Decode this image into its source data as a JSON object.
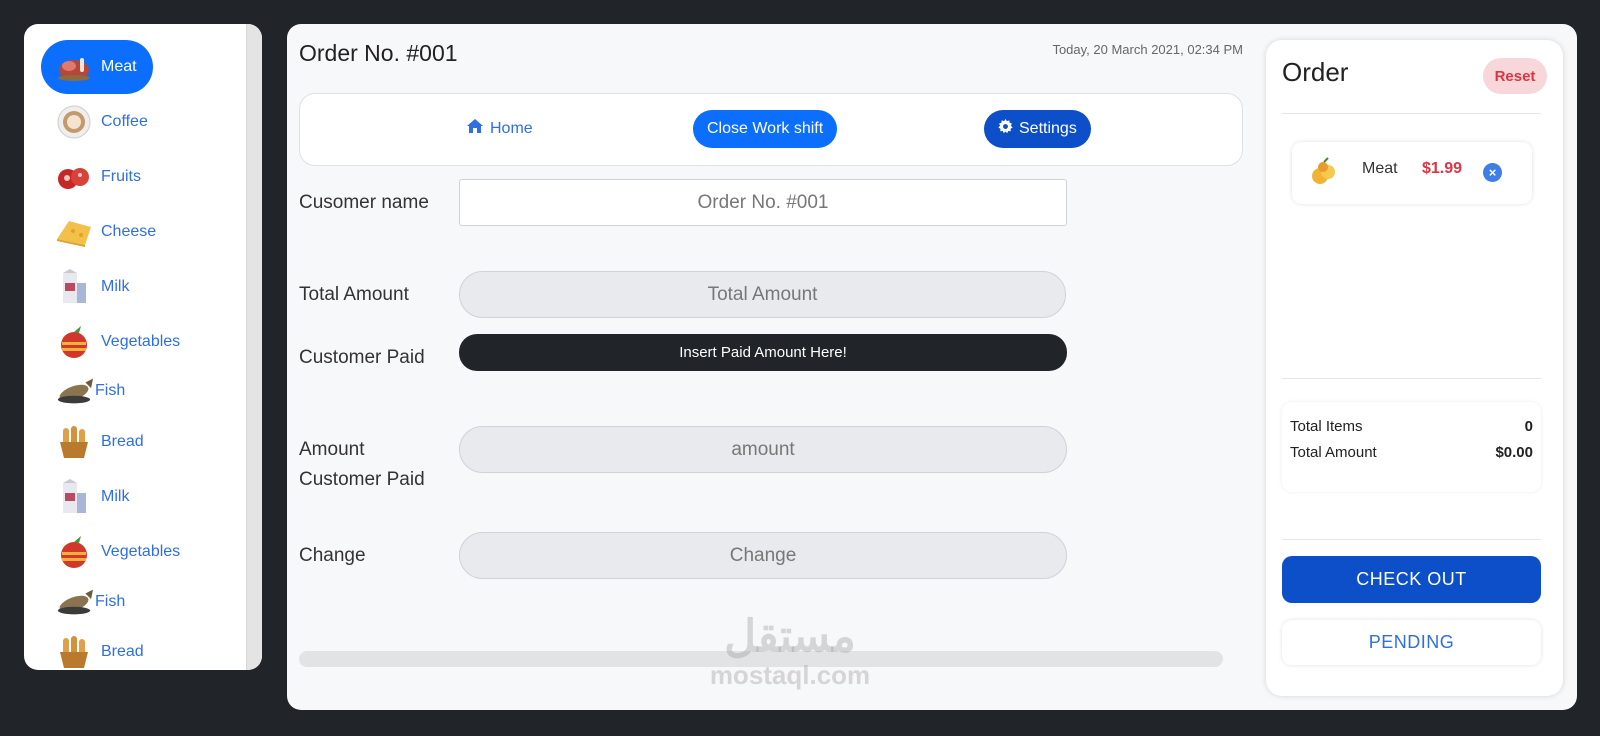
{
  "sidebar": {
    "categories": [
      {
        "label": "Meat",
        "icon": "meat-icon",
        "active": true
      },
      {
        "label": "Coffee",
        "icon": "coffee-icon"
      },
      {
        "label": "Fruits",
        "icon": "fruits-icon"
      },
      {
        "label": "Cheese",
        "icon": "cheese-icon"
      },
      {
        "label": "Milk",
        "icon": "milk-icon"
      },
      {
        "label": "Vegetables",
        "icon": "vegetables-icon"
      },
      {
        "label": "Fish",
        "icon": "fish-icon"
      },
      {
        "label": "Bread",
        "icon": "bread-icon"
      },
      {
        "label": "Milk",
        "icon": "milk-icon"
      },
      {
        "label": "Vegetables",
        "icon": "vegetables-icon"
      },
      {
        "label": "Fish",
        "icon": "fish-icon"
      },
      {
        "label": "Bread",
        "icon": "bread-icon"
      }
    ]
  },
  "header": {
    "order_no": "Order No. #001",
    "timestamp": "Today, 20 March 2021, 02:34 PM"
  },
  "nav": {
    "home": "Home",
    "close_shift": "Close Work shift",
    "settings": "Settings"
  },
  "form": {
    "customer_name_label": "Cusomer name",
    "customer_name_value": "Order No. #001",
    "total_amount_label": "Total Amount",
    "total_amount_placeholder": "Total Amount",
    "customer_paid_label": "Customer Paid",
    "paid_button": "Insert Paid Amount Here!",
    "amount_paid_label": "Amount Customer Paid",
    "amount_paid_placeholder": "amount",
    "change_label": "Change",
    "change_placeholder": "Change"
  },
  "order": {
    "title": "Order",
    "reset": "Reset",
    "items": [
      {
        "name": "Meat",
        "price": "$1.99"
      }
    ],
    "total_items_label": "Total Items",
    "total_items_value": "0",
    "total_amount_label": "Total Amount",
    "total_amount_value": "$0.00",
    "checkout": "CHECK OUT",
    "pending": "PENDING"
  },
  "watermark": {
    "arabic": "مستقل",
    "latin": "mostaql.com"
  },
  "colors": {
    "primary": "#0b6efd",
    "dark_primary": "#0d4fc9",
    "danger": "#dc3545",
    "dark": "#212428"
  }
}
